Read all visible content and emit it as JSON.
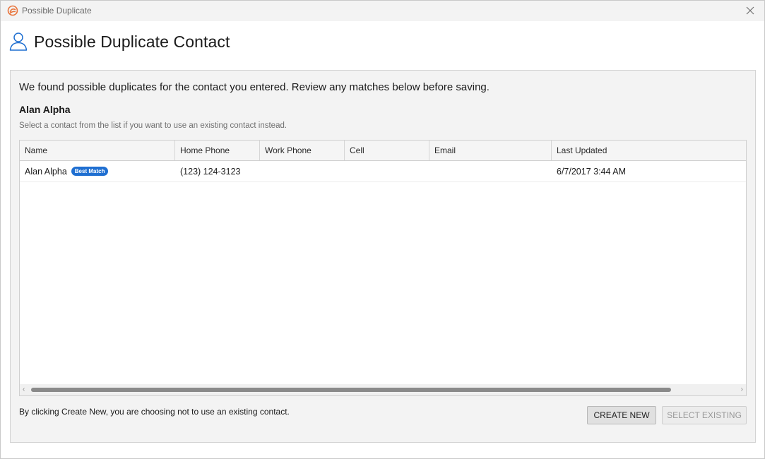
{
  "window": {
    "title": "Possible Duplicate"
  },
  "header": {
    "title": "Possible Duplicate Contact"
  },
  "panel": {
    "intro": "We found possible duplicates for the contact you entered. Review any matches below before saving.",
    "contact_name": "Alan Alpha",
    "hint": "Select a contact from the list if you want to use an existing contact instead."
  },
  "grid": {
    "columns": [
      "Name",
      "Home Phone",
      "Work Phone",
      "Cell",
      "Email",
      "Last Updated"
    ],
    "rows": [
      {
        "name": "Alan Alpha",
        "badge": "Best Match",
        "home_phone": "(123) 124-3123",
        "work_phone": "",
        "cell": "",
        "email": "",
        "last_updated": "6/7/2017 3:44 AM"
      }
    ]
  },
  "footer": {
    "note": "By clicking Create New, you are choosing not to use an existing contact.",
    "create_label": "CREATE NEW",
    "select_label": "SELECT EXISTING"
  },
  "colors": {
    "accent": "#1f6fd1",
    "app_icon": "#e8743b"
  },
  "icons": {
    "app": "sugarcrm-logo-icon",
    "header": "user-contact-icon",
    "close": "close-icon"
  }
}
